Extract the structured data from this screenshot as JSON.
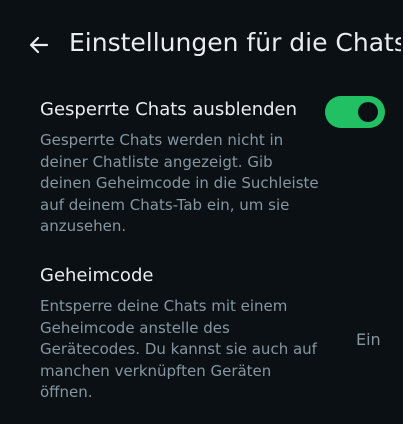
{
  "header": {
    "back_icon": "arrow-left-icon",
    "title": "Einstellungen für die Chatsp..."
  },
  "settings": [
    {
      "title": "Gesperrte Chats ausblenden",
      "description": "Gesperrte Chats werden nicht in deiner Chatliste angezeigt. Gib deinen Geheimcode in die Suchleiste auf deinem Chats-Tab ein, um sie anzusehen.",
      "control": "toggle",
      "toggle_state": "on"
    },
    {
      "title": "Geheimcode",
      "description": "Entsperre deine Chats mit einem Geheimcode anstelle des Gerätecodes. Du kannst sie auch auf manchen verknüpften Geräten öffnen.",
      "value": "Ein"
    }
  ],
  "colors": {
    "background": "#0b1014",
    "primary_text": "#e9edef",
    "secondary_text": "#8696a0",
    "accent": "#21c063"
  }
}
